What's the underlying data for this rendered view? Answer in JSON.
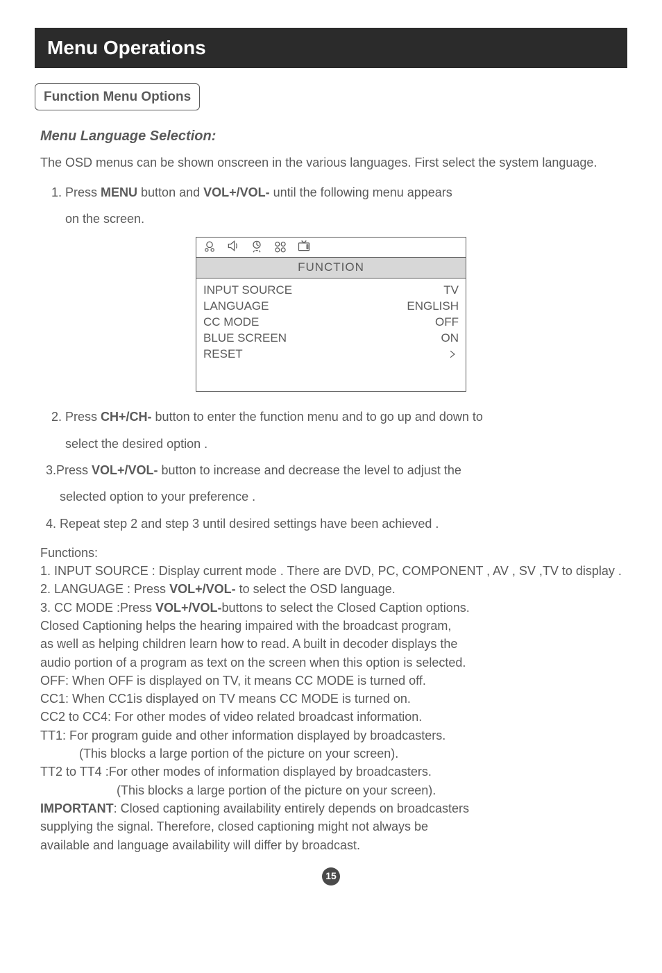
{
  "banner": "Menu Operations",
  "subhead": "Function Menu Options",
  "section_title": "Menu Language Selection:",
  "intro": "The OSD menus can be shown onscreen in the various languages. First select the system language.",
  "step1_a": "1. Press ",
  "step1_b": "MENU",
  "step1_c": " button and ",
  "step1_d": "VOL+/VOL-",
  "step1_e": " until the following menu appears",
  "step1_sub": "on the screen.",
  "osd": {
    "title": "FUNCTION",
    "rows": [
      {
        "l": "INPUT SOURCE",
        "r": "TV"
      },
      {
        "l": "LANGUAGE",
        "r": "ENGLISH"
      },
      {
        "l": "CC MODE",
        "r": "OFF"
      },
      {
        "l": "BLUE SCREEN",
        "r": "ON"
      }
    ],
    "reset": "RESET"
  },
  "step2_a": "2. Press ",
  "step2_b": "CH+/CH-",
  "step2_c": " button to enter the function menu and to go up and down to",
  "step2_sub": "select the desired option .",
  "step3_a": "3.Press ",
  "step3_b": "VOL+/VOL-",
  "step3_c": " button to increase and decrease the level to adjust the",
  "step3_sub": "selected option to your preference .",
  "step4": "4. Repeat step 2 and step 3 until desired settings have been achieved .",
  "functions_label": "Functions:",
  "f1": "1. INPUT SOURCE : Display current mode . There are DVD, PC, COMPONENT , AV , SV ,TV  to display .",
  "f2_a": "2. LANGUAGE : Press ",
  "f2_b": "VOL+/VOL-",
  "f2_c": " to select the OSD language.",
  "f3_a": "3. CC MODE :Press ",
  "f3_b": "VOL+/VOL-",
  "f3_c": "buttons to select the Closed Caption options.",
  "f3_l1": "Closed Captioning helps the hearing impaired with the broadcast program,",
  "f3_l2": "as well as helping children learn how to read.  A built in decoder displays the",
  "f3_l3": "audio portion of a program as text on the screen when this  option is selected.",
  "f3_off": "OFF:  When OFF is displayed on TV, it means CC MODE is turned off.",
  "f3_cc1": "CC1:  When CC1is displayed on TV means CC MODE is turned on.",
  "f3_cc2": "CC2 to CC4:  For other modes of video related broadcast information.",
  "f3_tt1": "TT1: For program guide and other information displayed by broadcasters.",
  "f3_tt1b": "(This blocks a large portion of the picture on your screen).",
  "f3_tt2": "TT2 to TT4 :For other modes of information displayed by broadcasters.",
  "f3_tt2b": "(This blocks a large portion of the picture on your screen).",
  "imp_b": "IMPORTANT",
  "imp_a": ": Closed captioning availability entirely depends on broadcasters",
  "imp_l1": "supplying the signal. Therefore, closed captioning might not always be",
  "imp_l2": "available and language availability will differ by broadcast.",
  "page": "15"
}
